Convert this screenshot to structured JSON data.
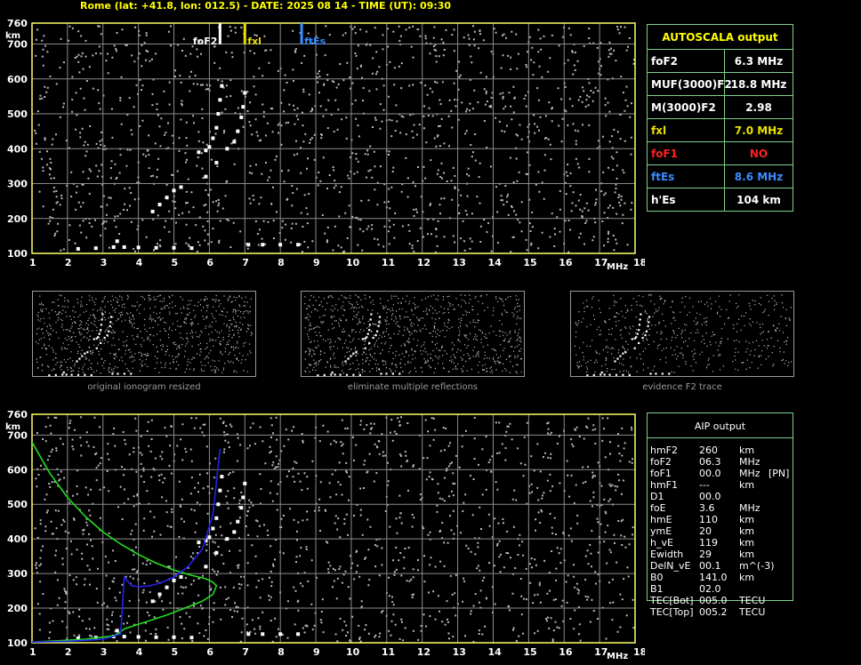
{
  "header": {
    "title": "Rome (lat: +41.8, lon: 012.5) - DATE: 2025 08 14 - TIME (UT): 09:30"
  },
  "axes": {
    "y_unit": "km",
    "x_unit": "MHz",
    "y_ticks": [
      "760",
      "700",
      "600",
      "500",
      "400",
      "300",
      "200",
      "100"
    ],
    "x_ticks": [
      "1",
      "2",
      "3",
      "4",
      "5",
      "6",
      "7",
      "8",
      "9",
      "10",
      "11",
      "12",
      "13",
      "14",
      "15",
      "16",
      "17",
      "18"
    ]
  },
  "markers": {
    "foF2_label": "foF2",
    "fxl_label": "fxl",
    "ftEs_label": "ftEs",
    "foF2_mhz": 6.3,
    "fxl_mhz": 7.0,
    "ftEs_mhz": 8.6
  },
  "autoscala": {
    "title": "AUTOSCALA output",
    "rows": [
      {
        "key": "foF2",
        "value": "6.3 MHz",
        "color": "#ffffff"
      },
      {
        "key": "MUF(3000)F2",
        "value": "18.8 MHz",
        "color": "#ffffff"
      },
      {
        "key": "M(3000)F2",
        "value": "2.98",
        "color": "#ffffff"
      },
      {
        "key": "fxl",
        "value": "7.0 MHz",
        "color": "#e8e000"
      },
      {
        "key": "foF1",
        "value": "NO",
        "color": "#ff2020"
      },
      {
        "key": "ftEs",
        "value": "8.6 MHz",
        "color": "#3a8cff"
      },
      {
        "key": "h'Es",
        "value": "104    km",
        "color": "#ffffff"
      }
    ]
  },
  "thumbnails": [
    {
      "caption": "original ionogram resized"
    },
    {
      "caption": "eliminate multiple reflections"
    },
    {
      "caption": "evidence F2 trace"
    }
  ],
  "aip": {
    "title": "AIP output",
    "rows": [
      {
        "k": "hmF2",
        "v": "260",
        "u": "km",
        "x": ""
      },
      {
        "k": "foF2",
        "v": "06.3",
        "u": "MHz",
        "x": ""
      },
      {
        "k": "foF1",
        "v": "00.0",
        "u": "MHz",
        "x": "[PN]"
      },
      {
        "k": "hmF1",
        "v": "---",
        "u": "km",
        "x": ""
      },
      {
        "k": "D1",
        "v": "00.0",
        "u": "",
        "x": ""
      },
      {
        "k": "foE",
        "v": "3.6",
        "u": "MHz",
        "x": ""
      },
      {
        "k": "hmE",
        "v": "110",
        "u": "km",
        "x": ""
      },
      {
        "k": "ymE",
        "v": "20",
        "u": "km",
        "x": ""
      },
      {
        "k": "h_vE",
        "v": "119",
        "u": "km",
        "x": ""
      },
      {
        "k": "Ewidth",
        "v": "29",
        "u": "km",
        "x": ""
      },
      {
        "k": "DelN_vE",
        "v": "00.1",
        "u": "m^(-3)",
        "x": ""
      },
      {
        "k": "B0",
        "v": "141.0",
        "u": "km",
        "x": ""
      },
      {
        "k": "B1",
        "v": "02.0",
        "u": "",
        "x": ""
      },
      {
        "k": "TEC[Bot]",
        "v": "005.0",
        "u": "TECU",
        "x": ""
      },
      {
        "k": "TEC[Top]",
        "v": "005.2",
        "u": "TECU",
        "x": ""
      }
    ]
  },
  "chart_data": [
    {
      "type": "scatter",
      "xlabel": "MHz",
      "ylabel": "km",
      "xlim": [
        1,
        18
      ],
      "ylim": [
        100,
        760
      ],
      "series": [
        {
          "name": "",
          "color": "#ffffff",
          "x": [
            2.3,
            2.8,
            3.3,
            3.4,
            3.6,
            4.0,
            4.5,
            5.0,
            5.5,
            4.4,
            4.6,
            4.8,
            5.0,
            5.2,
            5.7,
            5.9,
            6.0,
            6.1,
            6.2,
            6.25,
            6.3,
            6.35,
            5.9,
            6.2,
            6.5,
            6.7,
            6.8,
            6.9,
            6.95,
            7.0,
            7.1,
            7.5,
            8.0,
            8.5
          ],
          "y": [
            113,
            115,
            118,
            135,
            118,
            117,
            116,
            116,
            115,
            220,
            240,
            260,
            280,
            290,
            390,
            395,
            405,
            430,
            460,
            500,
            540,
            580,
            320,
            360,
            400,
            420,
            450,
            490,
            520,
            560,
            125,
            125,
            125,
            125
          ]
        }
      ]
    },
    {
      "type": "line",
      "xlabel": "MHz",
      "ylabel": "km",
      "xlim": [
        1,
        18
      ],
      "ylim": [
        100,
        760
      ],
      "series": [
        {
          "name": "",
          "color": "#22dd22",
          "x": [
            1.0,
            1.5,
            2.0,
            2.5,
            3.0,
            3.5,
            4.0,
            4.5,
            5.0,
            5.5,
            5.9,
            6.1,
            6.2,
            6.1,
            5.8,
            5.3,
            4.8,
            4.2,
            3.6,
            3.45,
            3.3,
            2.5,
            1.6,
            1.0
          ],
          "y": [
            680,
            590,
            520,
            465,
            420,
            385,
            355,
            330,
            310,
            295,
            285,
            275,
            265,
            240,
            220,
            200,
            180,
            160,
            140,
            128,
            120,
            110,
            105,
            102
          ]
        },
        {
          "name": "",
          "color": "#2222ee",
          "x": [
            1.0,
            2.0,
            3.0,
            3.5,
            3.6,
            3.8,
            4.0,
            4.3,
            4.6,
            5.0,
            5.4,
            5.8,
            6.1,
            6.3
          ],
          "y": [
            102,
            104,
            110,
            125,
            290,
            265,
            262,
            264,
            272,
            290,
            320,
            370,
            470,
            660
          ]
        }
      ]
    }
  ]
}
